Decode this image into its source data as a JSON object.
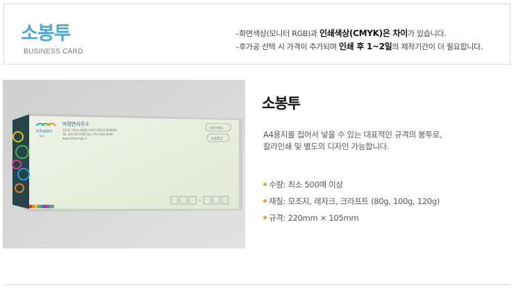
{
  "header": {
    "title": "소봉투",
    "subtitle": "BUSINESS CARD",
    "notice_line1": {
      "prefix": "–화면색상(모니터 RGB)과 ",
      "bold1": "인쇄색상(CMYK)은 차이",
      "suffix": "가 있습니다."
    },
    "notice_line2": {
      "prefix": "–후가공 선택 시 가격이 추가되며 ",
      "bold1": "인쇄 후 1~2일",
      "suffix": "의 제작기간이 더 필요합니다."
    }
  },
  "product": {
    "title": "소봉투",
    "description_line1": "A4용지를 접어서 넣을 수 있는 대표적인 규격의 봉투로,",
    "description_line2": "칼라인쇄 및 별도의 디자인 가능합니다.",
    "specs": [
      {
        "label": "수량: 최소 500매 이상"
      },
      {
        "label": "재질: 모조지, 레자크, 크라프트 (80g, 100g, 120g)"
      },
      {
        "label": "규격: 220mm × 105mm"
      }
    ]
  },
  "envelope_image": {
    "org_name": "이천시",
    "logo_text": "icheon",
    "office": "마장면사무소",
    "address": "경기도 이천시 마장면 오천로 (00)(오천2004)",
    "phone": "Tel. 031-00-2201   Fax. 031-644-4049",
    "web": "www.icheon.go.kr",
    "stamp_top": "이천우체국",
    "stamp_bottom": "요금후납"
  },
  "colors": {
    "accent": "#4fa7d6",
    "bullet": "#f0a02a",
    "envelope_band": "#24444a"
  }
}
